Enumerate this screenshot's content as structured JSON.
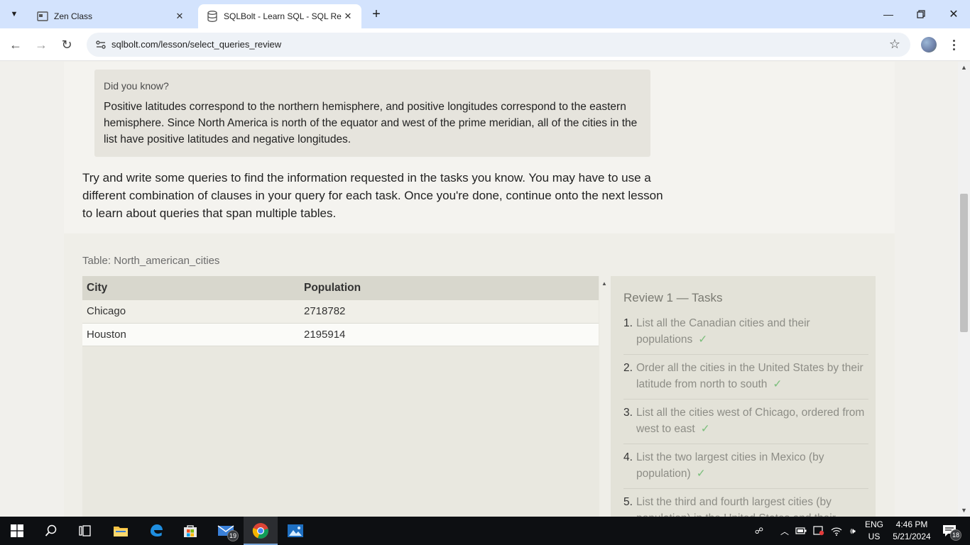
{
  "browser": {
    "tabs": [
      {
        "title": "Zen Class",
        "active": false
      },
      {
        "title": "SQLBolt - Learn SQL - SQL Revie",
        "active": true
      }
    ],
    "url": "sqlbolt.com/lesson/select_queries_review"
  },
  "page": {
    "tip": {
      "title": "Did you know?",
      "text": "Positive latitudes correspond to the northern hemisphere, and positive longitudes correspond to the eastern hemisphere. Since North America is north of the equator and west of the prime meridian, all of the cities in the list have positive latitudes and negative longitudes."
    },
    "lesson_text": "Try and write some queries to find the information requested in the tasks you know. You may have to use a different combination of clauses in your query for each task. Once you're done, continue onto the next lesson to learn about queries that span multiple tables.",
    "table": {
      "caption": "Table: North_american_cities",
      "columns": [
        "City",
        "Population"
      ],
      "rows": [
        [
          "Chicago",
          "2718782"
        ],
        [
          "Houston",
          "2195914"
        ]
      ]
    },
    "tasks": {
      "title": "Review 1 — Tasks",
      "check": "✓",
      "items": [
        {
          "num": "1.",
          "text": "List all the Canadian cities and their populations"
        },
        {
          "num": "2.",
          "text": "Order all the cities in the United States by their latitude from north to south"
        },
        {
          "num": "3.",
          "text": "List all the cities west of Chicago, ordered from west to east"
        },
        {
          "num": "4.",
          "text": "List the two largest cities in Mexico (by population)"
        },
        {
          "num": "5.",
          "text": "List the third and fourth largest cities (by population) in the United States and their population"
        }
      ]
    }
  },
  "taskbar": {
    "mail_badge": "19",
    "language": [
      "ENG",
      "US"
    ],
    "time": "4:46 PM",
    "date": "5/21/2024",
    "notifications": "18"
  }
}
